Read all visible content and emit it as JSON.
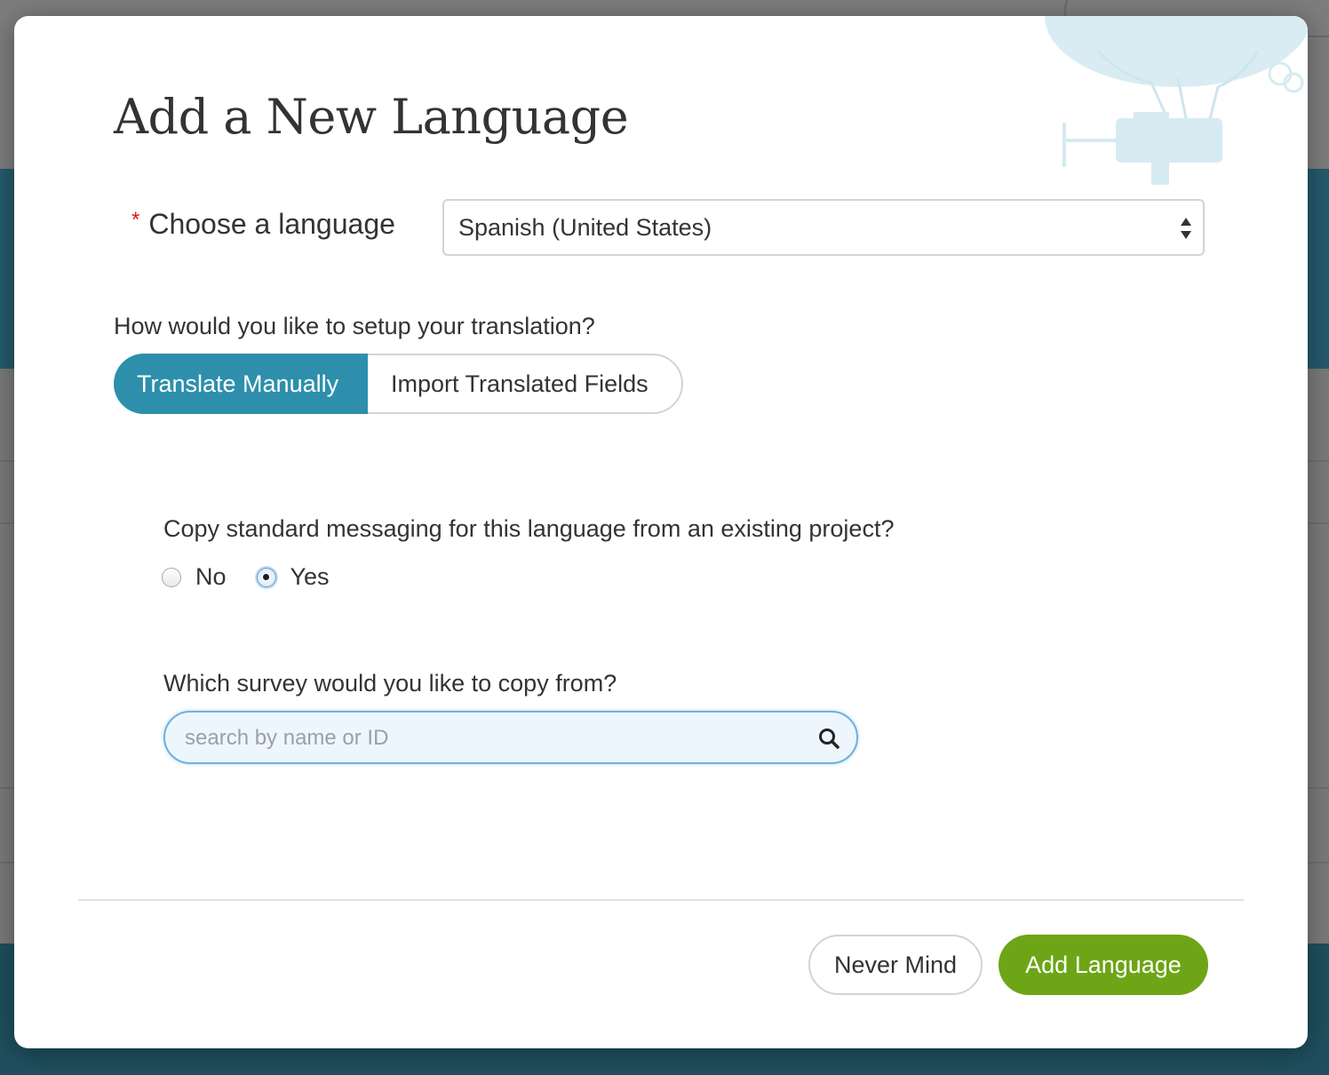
{
  "modal": {
    "title": "Add a New Language"
  },
  "language_field": {
    "required_marker": "*",
    "label": "Choose a language",
    "selected_value": "Spanish (United States)"
  },
  "setup": {
    "question": "How would you like to setup your translation?",
    "options": [
      {
        "label": "Translate Manually",
        "selected": true
      },
      {
        "label": "Import Translated Fields",
        "selected": false
      }
    ]
  },
  "copy_messaging": {
    "question": "Copy standard messaging for this language from an existing project?",
    "options": [
      {
        "label": "No",
        "checked": false
      },
      {
        "label": "Yes",
        "checked": true
      }
    ]
  },
  "survey_search": {
    "question": "Which survey would you like to copy from?",
    "placeholder": "search by name or ID",
    "value": ""
  },
  "footer": {
    "cancel_label": "Never Mind",
    "submit_label": "Add Language"
  },
  "colors": {
    "primary_toggle": "#2d8fab",
    "submit_button": "#6da517",
    "required_star": "#d9171c",
    "search_focus": "#6fb1de"
  },
  "icons": {
    "select": "up-down-arrows-icon",
    "search": "magnifier-icon",
    "decoration": "hot-air-balloon-illustration"
  }
}
